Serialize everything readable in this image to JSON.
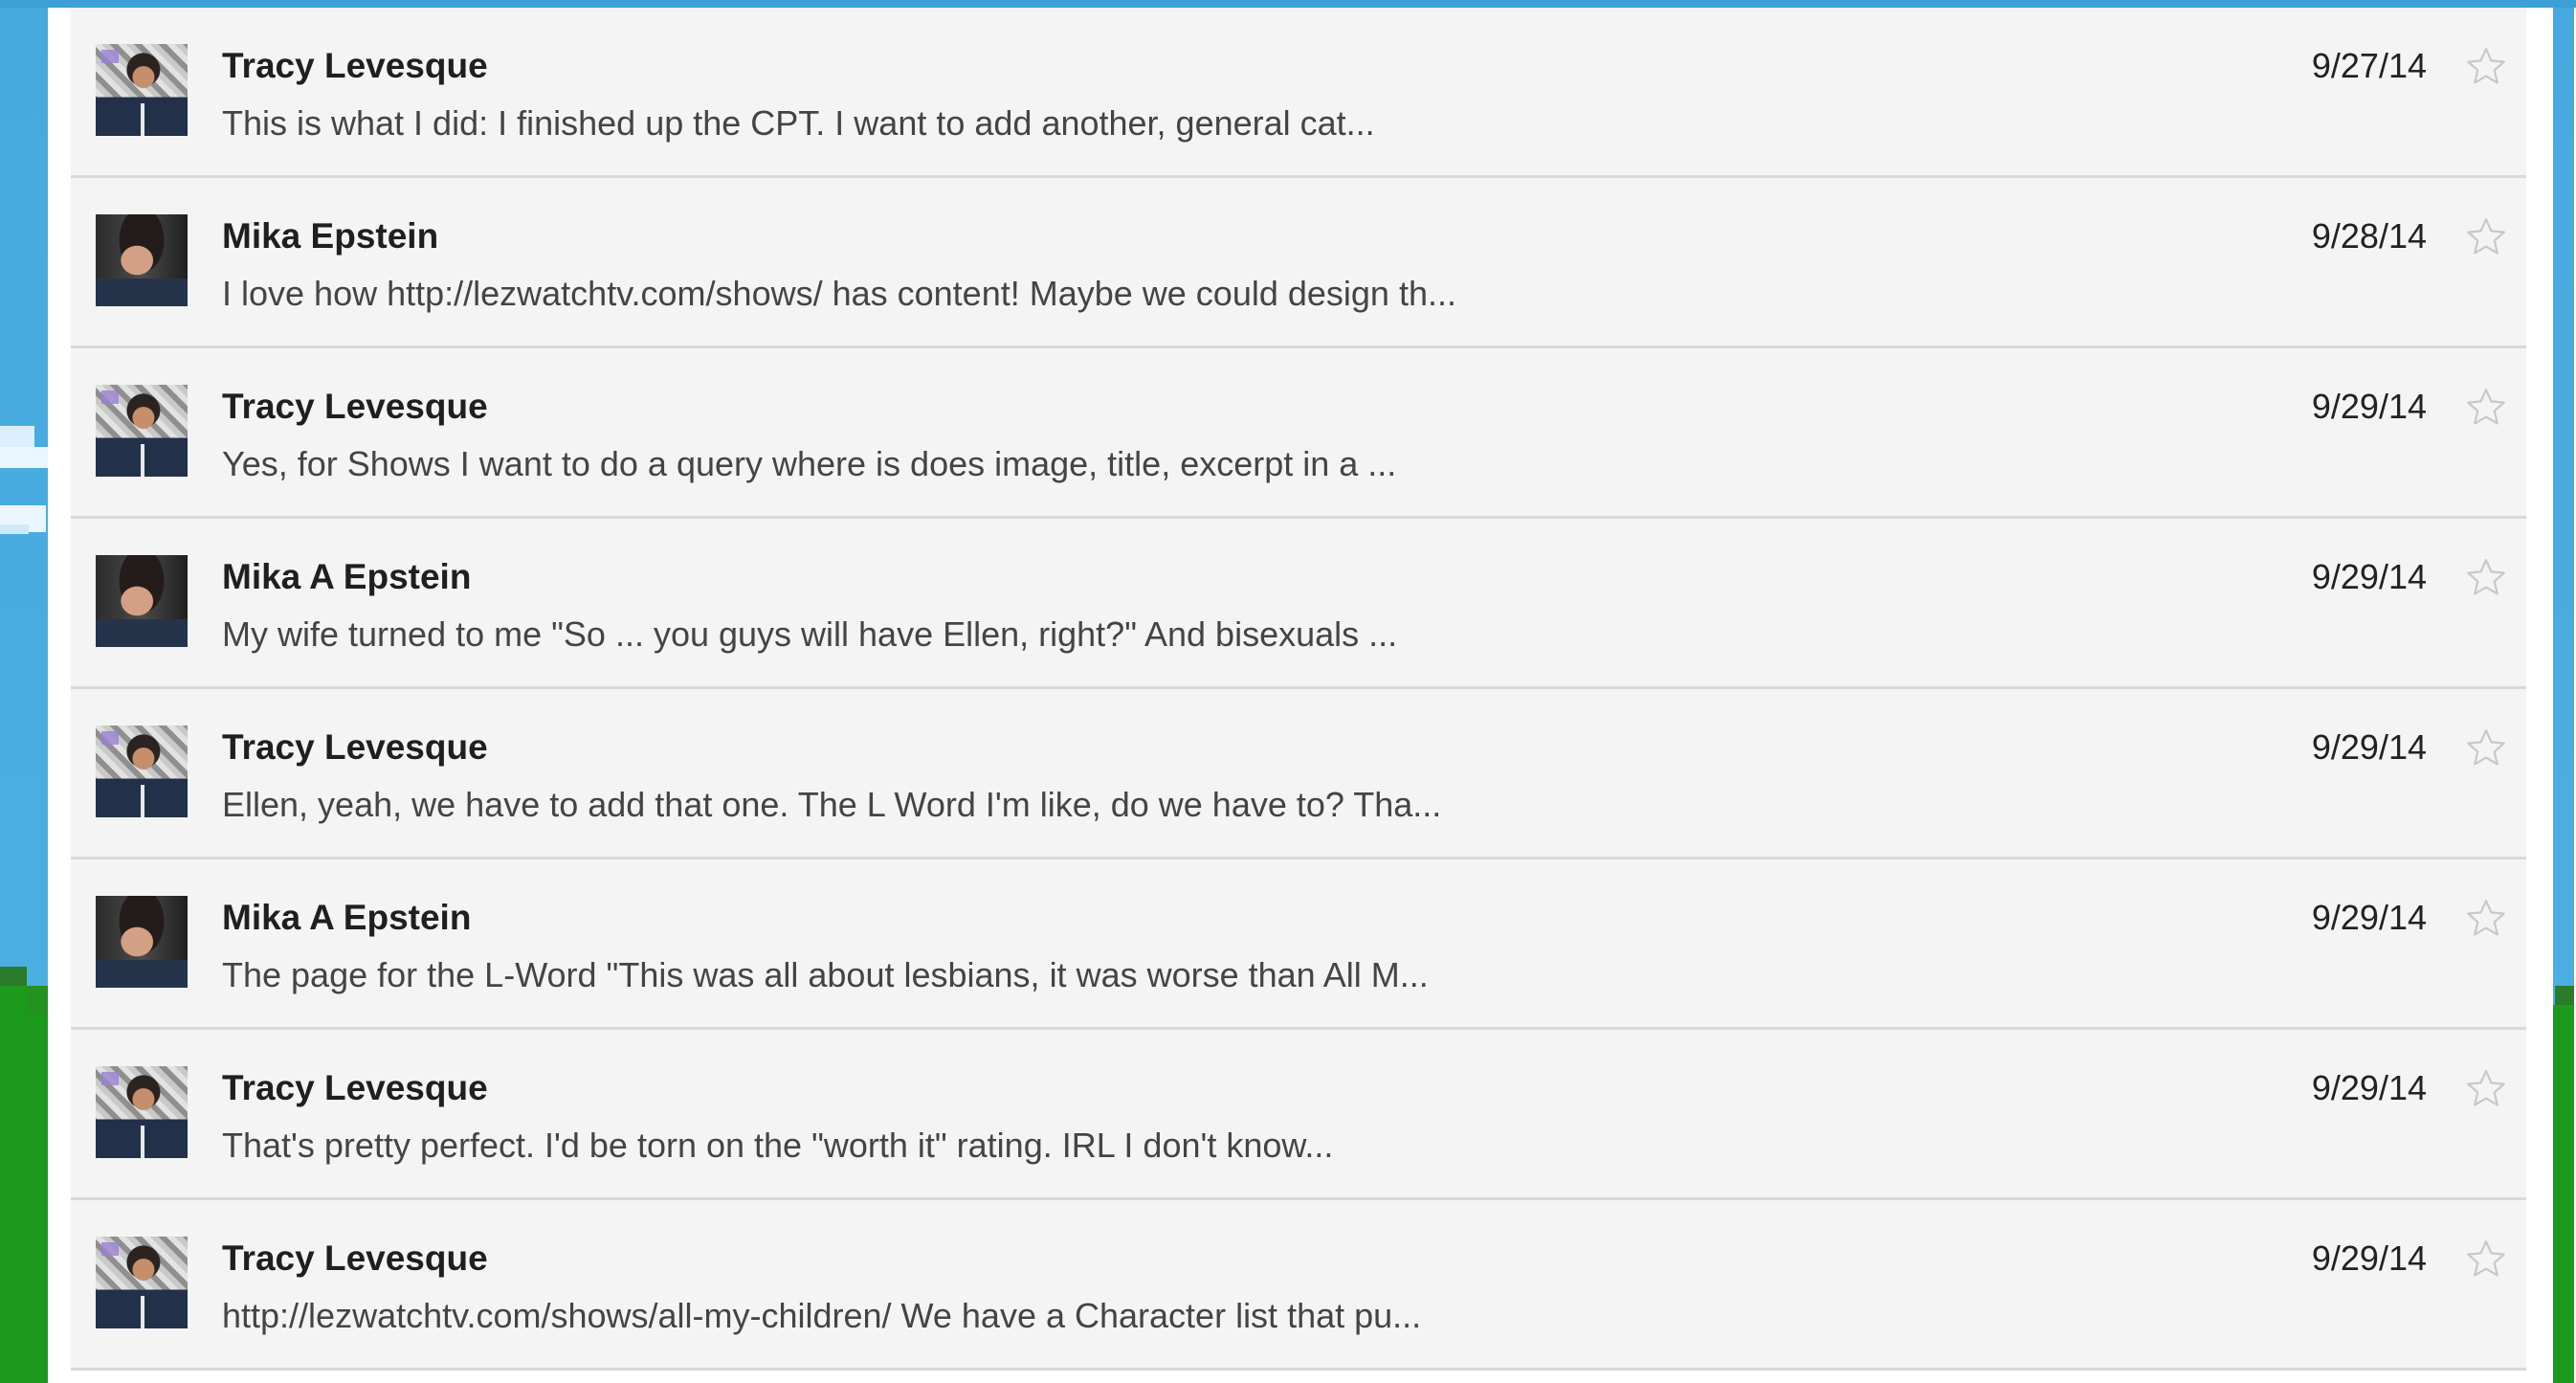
{
  "messages": [
    {
      "sender": "Tracy Levesque",
      "snippet": "This is what I did: I finished up the CPT. I want to add another, general cat...",
      "date": "9/27/14",
      "avatar": "tracy"
    },
    {
      "sender": "Mika Epstein",
      "snippet": "I love how http://lezwatchtv.com/shows/ has content! Maybe we could design th...",
      "date": "9/28/14",
      "avatar": "mika"
    },
    {
      "sender": "Tracy Levesque",
      "snippet": "Yes, for Shows I want to do a query where is does image, title, excerpt in a ...",
      "date": "9/29/14",
      "avatar": "tracy"
    },
    {
      "sender": "Mika A Epstein",
      "snippet": "My wife turned to me \"So ... you guys will have Ellen, right?\" And bisexuals ...",
      "date": "9/29/14",
      "avatar": "mika"
    },
    {
      "sender": "Tracy Levesque",
      "snippet": "Ellen, yeah, we have to add that one. The L Word I'm like, do we have to? Tha...",
      "date": "9/29/14",
      "avatar": "tracy"
    },
    {
      "sender": "Mika A Epstein",
      "snippet": "The page for the L-Word \"This was all about lesbians, it was worse than All M...",
      "date": "9/29/14",
      "avatar": "mika"
    },
    {
      "sender": "Tracy Levesque",
      "snippet": "That's pretty perfect. I'd be torn on the \"worth it\" rating. IRL I don't know...",
      "date": "9/29/14",
      "avatar": "tracy"
    },
    {
      "sender": "Tracy Levesque",
      "snippet": "http://lezwatchtv.com/shows/all-my-children/ We have a Character list that pu...",
      "date": "9/29/14",
      "avatar": "tracy"
    }
  ],
  "colors": {
    "row_bg": "#f4f4f4",
    "divider": "#d9d9d9",
    "star_outline": "#c8c8c8",
    "background_sky": "#46a9df"
  },
  "icons": {
    "star": "star-outline-icon"
  }
}
